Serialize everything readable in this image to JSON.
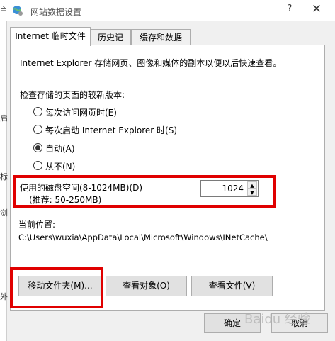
{
  "window": {
    "title": "网站数据设置",
    "help_label": "?",
    "close_label": "✕"
  },
  "left_edge_fragments": [
    "主",
    "启",
    "标",
    "浏",
    "外"
  ],
  "tabs": [
    {
      "label": "Internet 临时文件",
      "active": true
    },
    {
      "label": "历史记录",
      "active": false
    },
    {
      "label": "缓存和数据库",
      "active": false
    }
  ],
  "panel": {
    "description": "Internet Explorer 存储网页、图像和媒体的副本以便以后快速查看。",
    "check_label": "检查存储的页面的较新版本:",
    "radio_options": [
      {
        "label": "每次访问网页时(E)",
        "selected": false
      },
      {
        "label": "每次启动 Internet Explorer 时(S)",
        "selected": false
      },
      {
        "label": "自动(A)",
        "selected": true
      },
      {
        "label": "从不(N)",
        "selected": false
      }
    ],
    "disk_space_label": "使用的磁盘空间(8-1024MB)(D)",
    "disk_space_recommend": "(推荐: 50-250MB)",
    "disk_space_value": "1024",
    "location_label": "当前位置:",
    "location_path": "C:\\Users\\wuxia\\AppData\\Local\\Microsoft\\Windows\\INetCache\\",
    "buttons": {
      "move_folder": "移动文件夹(M)...",
      "view_objects": "查看对象(O)",
      "view_files": "查看文件(V)"
    }
  },
  "footer": {
    "ok": "确定",
    "cancel": "取消"
  },
  "watermark": "Baidu 经验",
  "colors": {
    "highlight": "#e00000",
    "panel_bg": "#ffffff",
    "dialog_bg": "#f0f0f0"
  }
}
